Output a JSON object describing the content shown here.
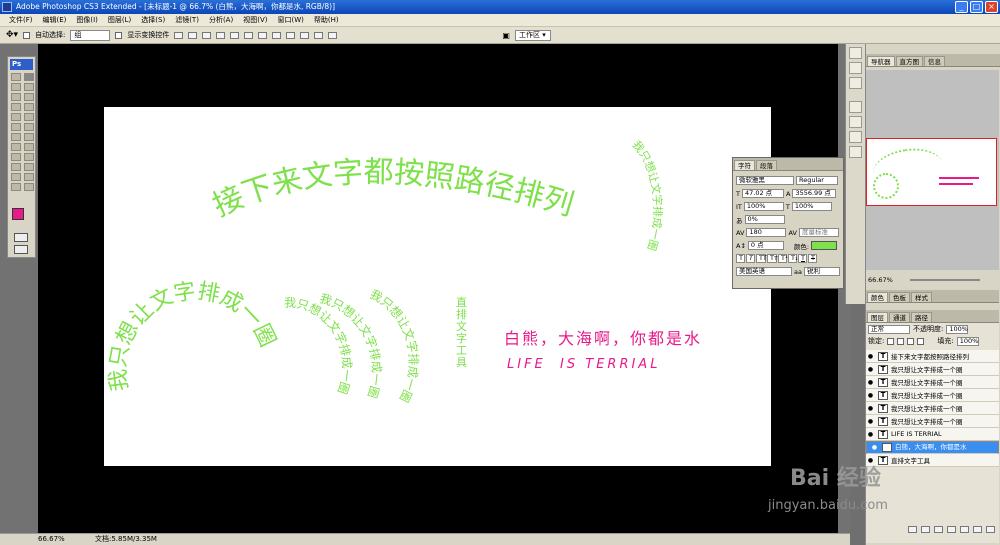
{
  "app": {
    "title": "Adobe Photoshop CS3 Extended - [未标题-1 @ 66.7% (白熊，大海啊，你都是水, RGB/8)]"
  },
  "menu": [
    "文件(F)",
    "编辑(E)",
    "图像(I)",
    "图层(L)",
    "选择(S)",
    "滤镜(T)",
    "分析(A)",
    "视图(V)",
    "窗口(W)",
    "帮助(H)"
  ],
  "options": {
    "auto_select": "自动选择:",
    "group": "组",
    "show_transform": "显示变换控件",
    "workspace": "工作区"
  },
  "toolbox": {
    "ps": "Ps"
  },
  "canvas": {
    "arc_top": "接下来文字都按照路径排列",
    "circle_right": "我只想让文字排成一圈",
    "circle_left": "我只想让文字排成一圈",
    "arc1": "我只想让文字排成一圈",
    "arc2": "我只想让文字排成一圈",
    "arc3": "我只想让文字排成一圈",
    "vertical": "直排文字工具",
    "pink_cn": "白熊，大海啊，你都是水",
    "pink_en": "LIFE  IS TERRIAL"
  },
  "charpanel": {
    "tabs": [
      "字符",
      "段落"
    ],
    "font": "微软雅黑",
    "style": "Regular",
    "size": "47.02 点",
    "leading": "3556.99 点",
    "vscale": "100%",
    "hscale": "100%",
    "baseline": "0%",
    "kerning": "180",
    "track": "度量标准",
    "shift": "0 点",
    "color_label": "颜色:",
    "language": "美国英语",
    "aa": "锐利",
    "text_color": "#7ee04a"
  },
  "navigator": {
    "tabs": [
      "导航器",
      "直方图",
      "信息"
    ],
    "zoom": "66.67%"
  },
  "colorpanel": {
    "tabs": [
      "颜色",
      "色板",
      "样式"
    ]
  },
  "layers": {
    "tabs": [
      "图层",
      "通道",
      "路径"
    ],
    "blend": "正常",
    "opacity_label": "不透明度:",
    "opacity": "100%",
    "lock_label": "锁定:",
    "fill_label": "填充:",
    "fill": "100%",
    "items": [
      {
        "name": "接下来文字都按照路径排列",
        "selected": false
      },
      {
        "name": "我只想让文字排成一个圈",
        "selected": false
      },
      {
        "name": "我只想让文字排成一个圈",
        "selected": false
      },
      {
        "name": "我只想让文字排成一个圈",
        "selected": false
      },
      {
        "name": "我只想让文字排成一个圈",
        "selected": false
      },
      {
        "name": "我只想让文字排成一个圈",
        "selected": false
      },
      {
        "name": "LIFE IS TERRIAL",
        "selected": false
      },
      {
        "name": "白熊，大海啊，你都是水",
        "selected": true
      },
      {
        "name": "直排文字工具",
        "selected": false
      }
    ]
  },
  "status": {
    "zoom": "66.67%",
    "doc": "文档:5.85M/3.35M"
  },
  "watermark": {
    "brand": "Bai  经验",
    "url": "jingyan.baidu.com"
  },
  "colors": {
    "green": "#7ee04a",
    "pink": "#e8198a",
    "fg": "#e8198a"
  }
}
